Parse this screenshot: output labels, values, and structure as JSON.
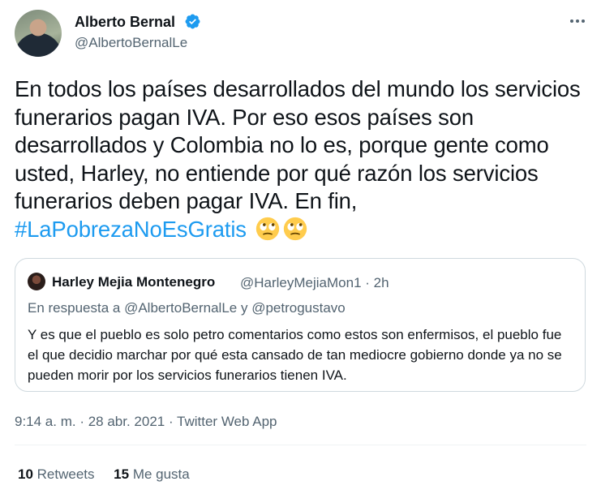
{
  "author": {
    "name": "Alberto Bernal",
    "handle": "@AlbertoBernalLe"
  },
  "tweet": {
    "text": "En todos los países desarrollados del mundo los servicios funerarios pagan IVA. Por eso esos países son desarrollados y Colombia no lo es, porque gente como usted, Harley, no entiende por qué razón los servicios funerarios deben pagar IVA. En fin,",
    "hashtag": "#LaPobrezaNoEsGratis",
    "emojis": [
      "face-with-rolling-eyes-icon",
      "face-with-rolling-eyes-icon"
    ]
  },
  "quoted": {
    "name": "Harley Mejia Montenegro",
    "handle": "@HarleyMejiaMon1",
    "separator": "·",
    "time": "2h",
    "reply_to": "En respuesta a @AlbertoBernalLe y @petrogustavo",
    "text": "Y es que el pueblo es solo petro comentarios como estos son enfermisos, el pueblo fue el que decidio marchar por qué esta cansado de tan mediocre gobierno donde ya no se pueden morir por los servicios funerarios tienen IVA."
  },
  "meta": {
    "timestamp": "9:14 a. m. · 28 abr. 2021 · Twitter Web App"
  },
  "stats": {
    "retweets_count": "10",
    "retweets_label": "Retweets",
    "likes_count": "15",
    "likes_label": "Me gusta"
  },
  "colors": {
    "accent": "#1d9bf0",
    "text": "#0f1419",
    "secondary": "#536471",
    "border": "#cfd9de"
  }
}
